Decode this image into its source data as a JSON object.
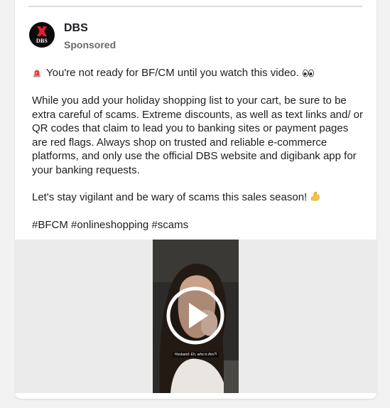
{
  "post": {
    "page_name": "DBS",
    "sponsored_label": "Sponsored",
    "avatar_logo_text": "DBS",
    "headline": "You're not ready for BF/CM until you watch this video.",
    "headline_lead_icon": "siren-emoji",
    "headline_trail_icon": "eyes-emoji",
    "paragraph": "While you add your holiday shopping list to your cart, be sure to be extra careful of scams. Extreme discounts, as well as text links and/ or QR codes that claim to lead you to banking sites or payment pages are red flags. Always shop on trusted and reliable e-commerce platforms, and only use the official DBS website and digibank app for your banking requests.",
    "closing": "Let's stay vigilant and be wary of scams this sales season!",
    "closing_icon": "flexed-biceps-emoji",
    "hashtags": "#BFCM #onlineshopping #scams"
  },
  "video": {
    "caption": "Husband: Eh, who is this?!",
    "play_icon": "play-icon"
  },
  "colors": {
    "brand_red": "#e5202e",
    "text": "#1c1e21",
    "muted": "#6b6b6b"
  }
}
